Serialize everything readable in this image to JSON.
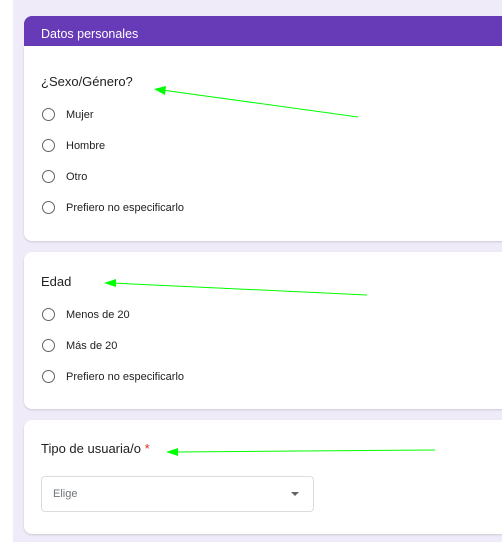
{
  "section": {
    "title": "Datos personales",
    "accent_color": "#673ab7"
  },
  "questions": [
    {
      "title": "¿Sexo/Género?",
      "options": [
        "Mujer",
        "Hombre",
        "Otro",
        "Prefiero no especificarlo"
      ]
    },
    {
      "title": "Edad",
      "options": [
        "Menos de 20",
        "Más de 20",
        "Prefiero no especificarlo"
      ]
    },
    {
      "title": "Tipo de usuaria/o",
      "required_mark": "*",
      "dropdown": {
        "selected": "Elige",
        "icon": "caret-down-icon"
      }
    }
  ],
  "annotations": {
    "arrow_color": "#00ff00"
  }
}
